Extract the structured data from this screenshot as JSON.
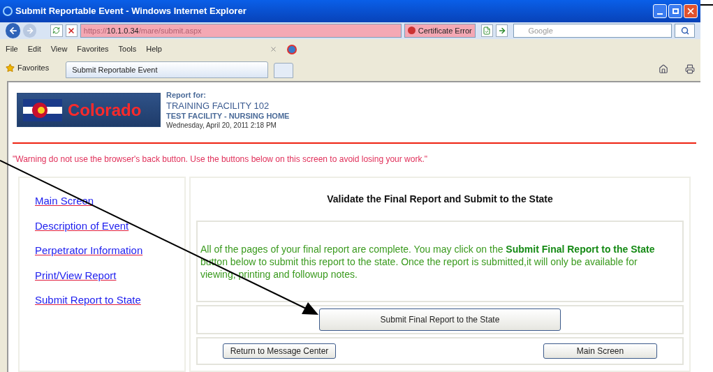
{
  "window": {
    "title": "Submit Reportable Event - Windows Internet Explorer"
  },
  "address_bar": {
    "scheme": "https://",
    "host": "10.1.0.34",
    "path": "/mare/submit.aspx",
    "certificate_error": "Certificate Error"
  },
  "search": {
    "placeholder": "Google"
  },
  "menu": [
    "File",
    "Edit",
    "View",
    "Favorites",
    "Tools",
    "Help"
  ],
  "favorites_bar": {
    "label": "Favorites",
    "tab": "Submit Reportable Event"
  },
  "header": {
    "logo_text": "Colorado",
    "report_for_label": "Report for:",
    "facility": "TRAINING FACILITY 102",
    "facility_type": "TEST FACILITY - NURSING HOME",
    "date": "Wednesday, April 20, 2011 2:18 PM"
  },
  "warning": "\"Warning do not use the browser's back button. Use the buttons below on this screen to avoid losing your work.\"",
  "nav_links": [
    "Main Screen",
    "Description of Event",
    "Perpetrator Information",
    "Print/View Report",
    "Submit Report to State"
  ],
  "main": {
    "heading": "Validate the Final Report and Submit to the State",
    "message": "All of the pages of your final report are complete. You may click on the **Submit Final Report to the State** button below to submit this report to the state. Once the report is submitted,it will only be available for viewing, printing and followup notes.",
    "submit_button": "Submit Final Report to the State",
    "return_button": "Return to Message Center",
    "main_button": "Main Screen"
  }
}
